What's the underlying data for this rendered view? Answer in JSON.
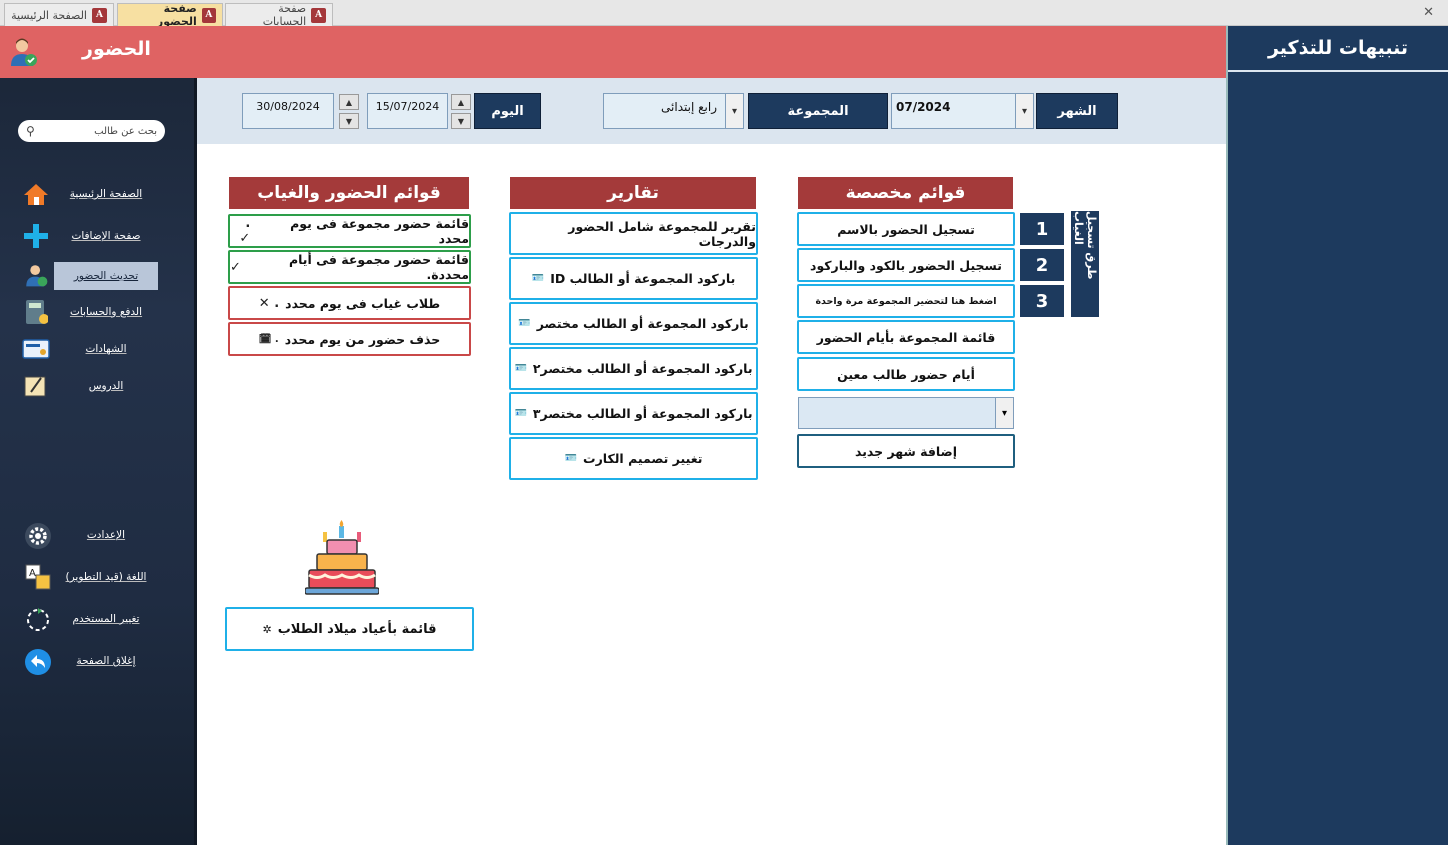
{
  "tabs": [
    {
      "label": "الصفحة الرئيسية"
    },
    {
      "label": "صفحة الحضور"
    },
    {
      "label": "صفحة الحسابات"
    }
  ],
  "window": {
    "close": "✕"
  },
  "header": {
    "title": "الحضور"
  },
  "search": {
    "placeholder": "بحث عن طالب"
  },
  "nav": {
    "items": [
      {
        "label": "الصفحة الرئيسية",
        "icon": "house-icon"
      },
      {
        "label": "صفحة الإضافات",
        "icon": "plus-icon"
      },
      {
        "label": "تحديث الحضور",
        "icon": "attendance-user-icon"
      },
      {
        "label": "الدفع والحسابات",
        "icon": "calculator-icon"
      },
      {
        "label": "الشهادات",
        "icon": "certificate-icon"
      },
      {
        "label": "الدروس",
        "icon": "book-icon"
      }
    ],
    "bottom": [
      {
        "label": "الإعدادت",
        "icon": "gear-icon"
      },
      {
        "label": "اللغة (قيد التطوير)",
        "icon": "translate-icon"
      },
      {
        "label": "تغيير المستخدم",
        "icon": "refresh-icon"
      },
      {
        "label": "إغلاق الصفحة",
        "icon": "back-arrow-icon"
      }
    ]
  },
  "filters": {
    "month_label": "الشهر",
    "month_value": "07/2024",
    "group_label": "المجموعة",
    "group_value": "رابع إبتدائى",
    "day_label": "اليوم",
    "date_from": "15/07/2024",
    "date_to": "30/08/2024"
  },
  "sections": {
    "attendance_lists": {
      "title": "قوائم الحضور والغياب",
      "items": [
        {
          "label": "قائمة حضور مجموعة فى يوم محدد",
          "mark": ".  ✓"
        },
        {
          "label": "قائمة حضور مجموعة فى أيام محددة.",
          "mark": "✓"
        },
        {
          "label": "طلاب غياب فى يوم محدد",
          "mark": ".  ✕"
        },
        {
          "label": "حذف حضور من يوم محدد",
          "mark": ".  🗓"
        }
      ]
    },
    "reports": {
      "title": "تقارير",
      "items": [
        {
          "label": "تقرير للمجموعة شامل الحضور والدرجات"
        },
        {
          "label": "باركود المجموعة أو الطالب ID"
        },
        {
          "label": "باركود المجموعة أو الطالب مختصر"
        },
        {
          "label": "باركود المجموعة أو الطالب مختصر٢"
        },
        {
          "label": "باركود المجموعة أو الطالب مختصر٣"
        },
        {
          "label": "تغيير تصميم الكارت"
        }
      ]
    },
    "custom_lists": {
      "title": "قوائم مخصصة",
      "items": [
        {
          "label": "تسجيل الحضور بالاسم",
          "num": "1"
        },
        {
          "label": "تسجيل الحضور بالكود والباركود",
          "num": "2"
        },
        {
          "label": "اضغط هنا لتحضير المجموعة مرة واحدة",
          "num": "3"
        },
        {
          "label": "قائمة المجموعة بأيام الحضور"
        },
        {
          "label": "أيام حضور طالب معين"
        }
      ],
      "add_month": "إضافة شهر جديد",
      "methods_label": "طرق تسجيل الغياب"
    },
    "birthdays": {
      "label": "قائمة بأعياد ميلاد الطلاب"
    }
  },
  "alerts": {
    "title": "تنبيهات للتذكير"
  },
  "colors": {
    "header": "#df6363",
    "navy": "#1d3a5e",
    "section": "#a43a3a",
    "accent_border": "#1fb0e8"
  }
}
